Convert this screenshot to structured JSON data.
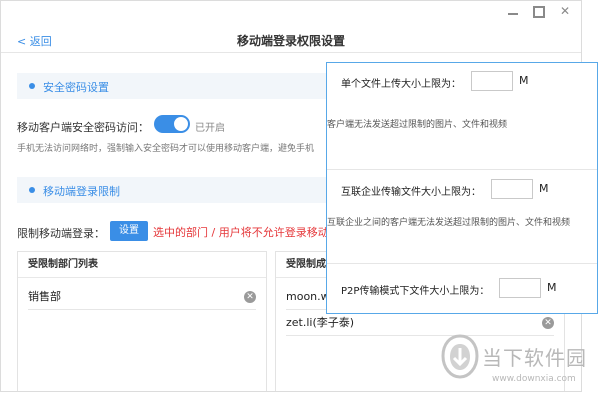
{
  "window": {
    "back_label": "< 返回",
    "title": "移动端登录权限设置"
  },
  "security_section": {
    "heading": "安全密码设置",
    "access_label": "移动客户端安全密码访问：",
    "toggle_state": "已开启",
    "toggle_on": true,
    "hint": "手机无法访问网络时，强制输入安全密码才可以使用移动客户端，避免手机"
  },
  "login_section": {
    "heading": "移动端登录限制",
    "restrict_label": "限制移动端登录：",
    "set_button": "设置",
    "warning": "选中的部门 / 用户将不允许登录移动端"
  },
  "dept_panel": {
    "header": "受限制部门列表",
    "items": [
      "销售部"
    ]
  },
  "member_panel": {
    "header": "受限制成员",
    "items": [
      "moon.wu",
      "zet.li(李子泰)"
    ]
  },
  "popup": {
    "single_label": "单个文件上传大小上限为：",
    "single_unit": "M",
    "single_hint": "客户端无法发送超过限制的图片、文件和视频",
    "inter_label": "互联企业传输文件大小上限为：",
    "inter_unit": "M",
    "inter_hint": "互联企业之间的客户端无法发送超过限制的图片、文件和视频",
    "p2p_label": "P2P传输模式下文件大小上限为：",
    "p2p_unit": "M"
  },
  "watermark": {
    "name": "当下软件园",
    "url": "www.downxia.com"
  },
  "colors": {
    "accent": "#3a8ee6",
    "warning": "#e5373a",
    "popup_border": "#58a8e8"
  }
}
